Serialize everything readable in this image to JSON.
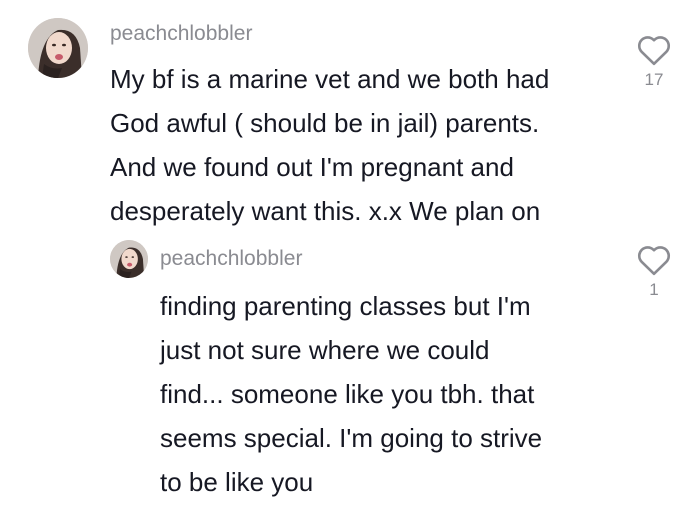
{
  "comments": [
    {
      "username": "peachchlobbler",
      "text": "My bf is a marine vet and we both had\nGod awful ( should be in jail) parents.\nAnd we found out I'm pregnant and\ndesperately want this. x.x We plan on",
      "likes": "17",
      "like_icon": "heart-outline-icon"
    }
  ],
  "reply": {
    "username": "peachchlobbler",
    "text": "finding parenting classes but I'm\njust not sure where we could\nfind... someone like you tbh. that\nseems special. I'm going to strive\nto be like you",
    "likes": "1",
    "like_icon": "heart-outline-icon"
  },
  "colors": {
    "text": "#161823",
    "muted": "#8a8b91",
    "icon": "#8a8b91"
  }
}
